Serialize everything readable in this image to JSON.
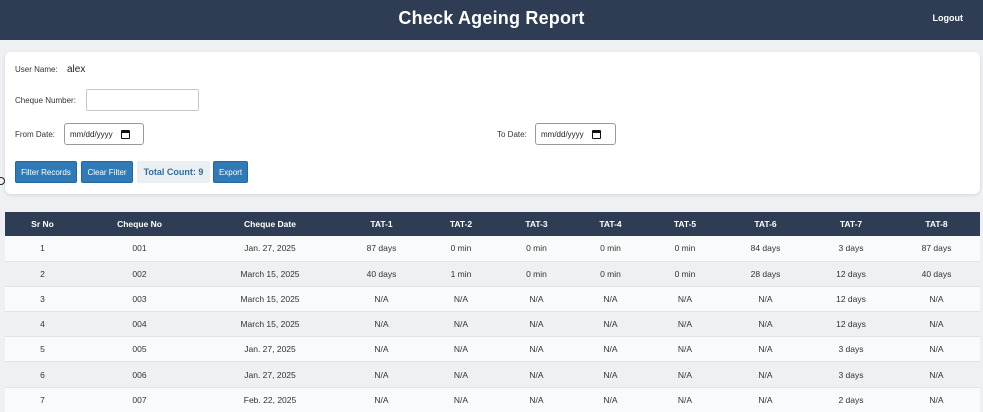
{
  "header": {
    "title": "Check Ageing Report",
    "logout_label": "Logout"
  },
  "filters": {
    "user_name_label": "User Name:",
    "user_name_value": "alex",
    "cheque_number_label": "Cheque Number:",
    "cheque_number_value": "",
    "from_date_label": "From Date:",
    "to_date_label": "To Date:",
    "date_placeholder": "mm/dd/yyyy"
  },
  "actions": {
    "filter_label": "Filter Records",
    "clear_label": "Clear Filter",
    "total_count_text": "Total Count: 9",
    "export_label": "Export"
  },
  "table": {
    "headers": [
      "Sr No",
      "Cheque No",
      "Cheque Date",
      "TAT-1",
      "TAT-2",
      "TAT-3",
      "TAT-4",
      "TAT-5",
      "TAT-6",
      "TAT-7",
      "TAT-8"
    ],
    "rows": [
      [
        "1",
        "001",
        "Jan. 27, 2025",
        "87 days",
        "0 min",
        "0 min",
        "0 min",
        "0 min",
        "84 days",
        "3 days",
        "87 days"
      ],
      [
        "2",
        "002",
        "March 15, 2025",
        "40 days",
        "1 min",
        "0 min",
        "0 min",
        "0 min",
        "28 days",
        "12 days",
        "40 days"
      ],
      [
        "3",
        "003",
        "March 15, 2025",
        "N/A",
        "N/A",
        "N/A",
        "N/A",
        "N/A",
        "N/A",
        "12 days",
        "N/A"
      ],
      [
        "4",
        "004",
        "March 15, 2025",
        "N/A",
        "N/A",
        "N/A",
        "N/A",
        "N/A",
        "N/A",
        "12 days",
        "N/A"
      ],
      [
        "5",
        "005",
        "Jan. 27, 2025",
        "N/A",
        "N/A",
        "N/A",
        "N/A",
        "N/A",
        "N/A",
        "3 days",
        "N/A"
      ],
      [
        "6",
        "006",
        "Jan. 27, 2025",
        "N/A",
        "N/A",
        "N/A",
        "N/A",
        "N/A",
        "N/A",
        "3 days",
        "N/A"
      ],
      [
        "7",
        "007",
        "Feb. 22, 2025",
        "N/A",
        "N/A",
        "N/A",
        "N/A",
        "N/A",
        "N/A",
        "2 days",
        "N/A"
      ]
    ]
  }
}
